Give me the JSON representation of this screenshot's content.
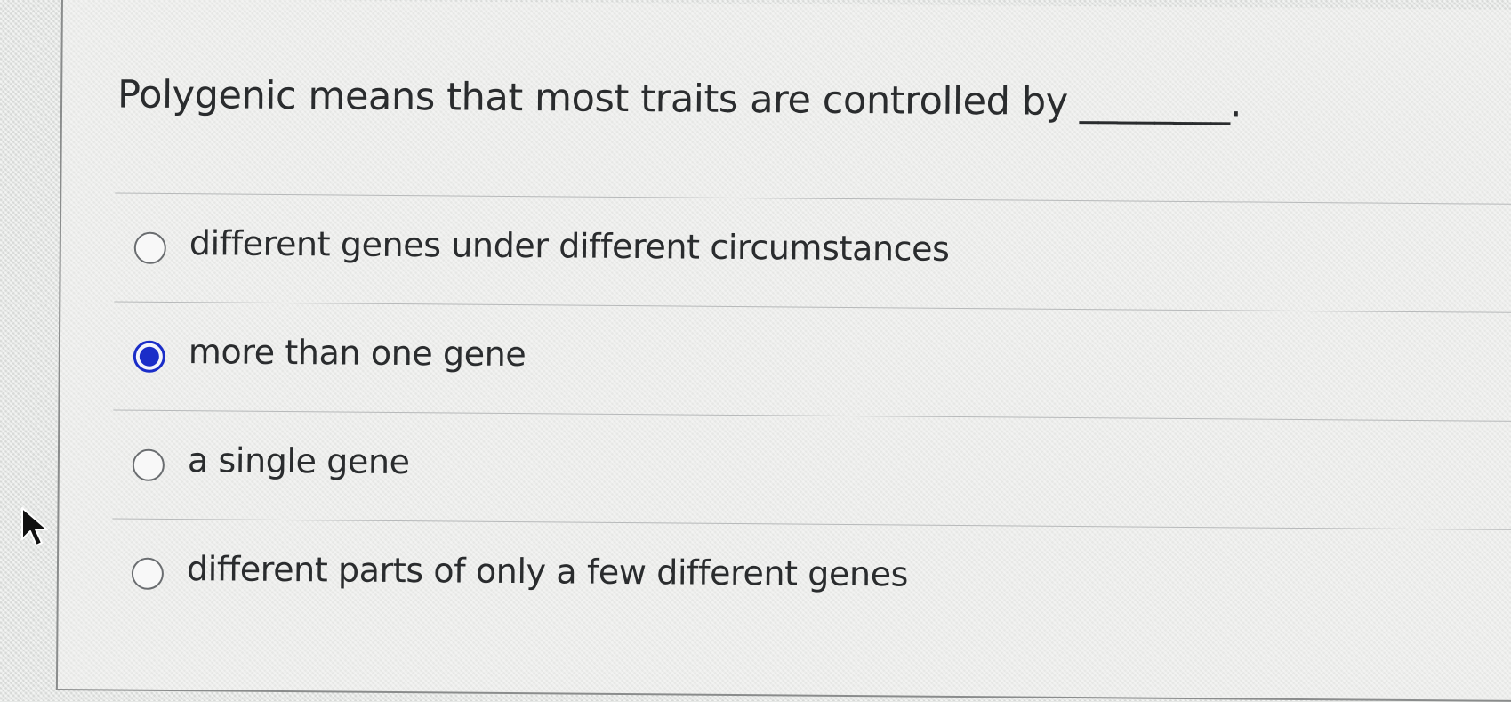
{
  "question": {
    "text": "Polygenic means that most traits are controlled by ________."
  },
  "options": [
    {
      "label": "different genes under different circumstances",
      "selected": false
    },
    {
      "label": "more than one gene",
      "selected": true
    },
    {
      "label": "a single gene",
      "selected": false
    },
    {
      "label": "different parts of only a few different genes",
      "selected": false
    }
  ],
  "colors": {
    "selected_radio": "#1a2dc8",
    "text": "#2a2c2e",
    "background": "#e6e8e6"
  },
  "cursor": {
    "icon": "arrow-pointer-icon"
  }
}
